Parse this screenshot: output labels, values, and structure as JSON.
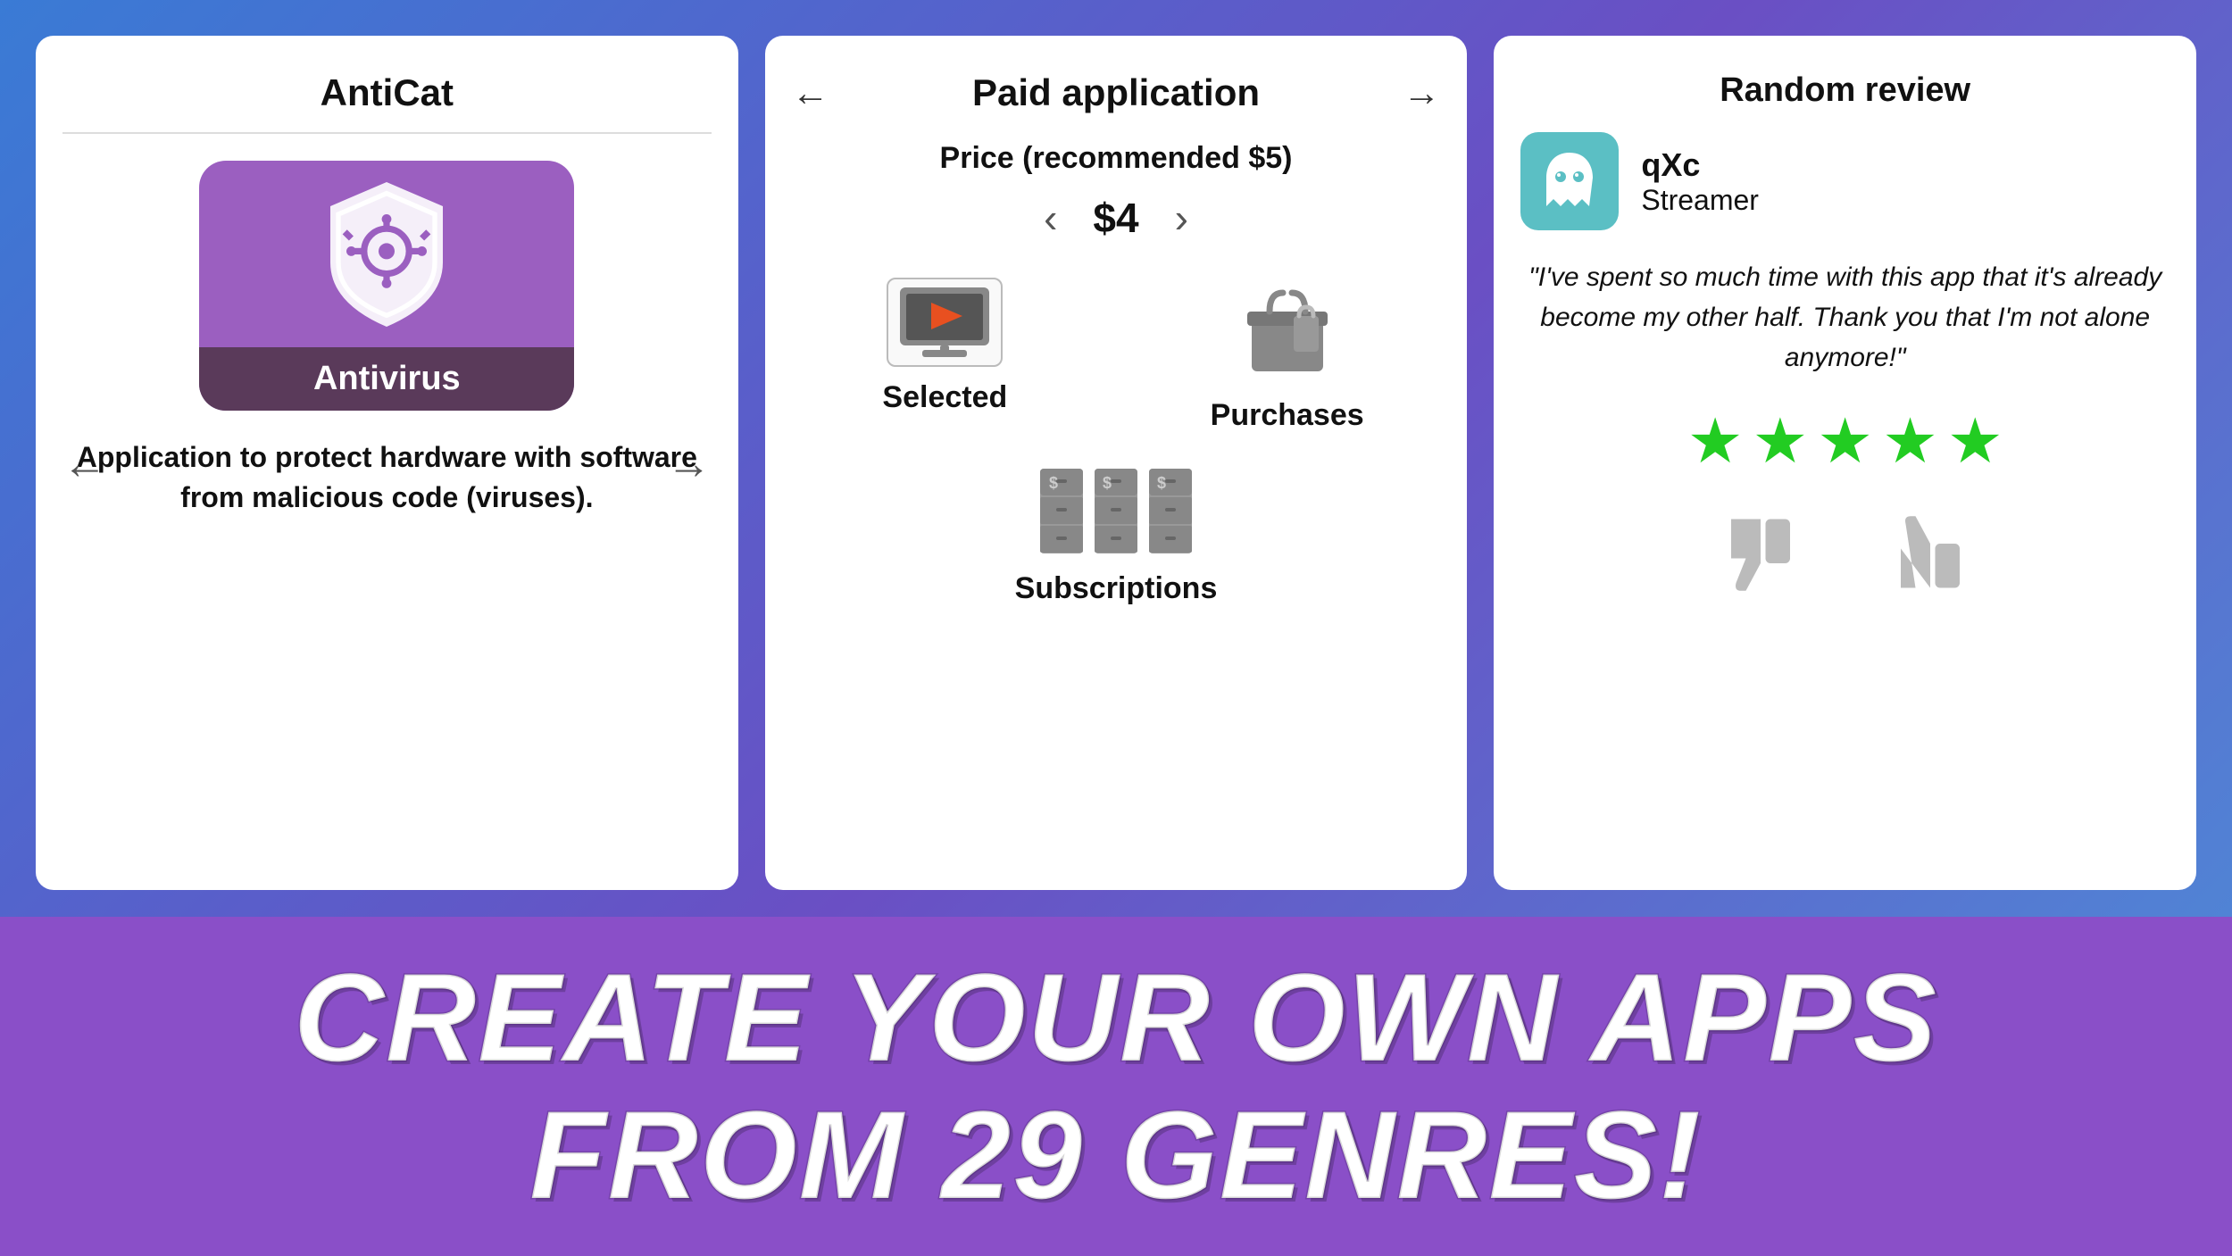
{
  "card1": {
    "title": "AntiCat",
    "app_name": "Antivirus",
    "description": "Application to protect hardware with software from malicious code (viruses).",
    "nav_left": "←",
    "nav_right": "→"
  },
  "card2": {
    "header": "Paid application",
    "nav_left": "←",
    "nav_right": "→",
    "price_label": "Price (recommended $5)",
    "price": "$4",
    "price_prev": "‹",
    "price_next": "›",
    "options": [
      {
        "label": "Selected",
        "type": "selected"
      },
      {
        "label": "Purchases",
        "type": "purchases"
      },
      {
        "label": "Subscriptions",
        "type": "subscriptions"
      }
    ]
  },
  "card3": {
    "header": "Random review",
    "reviewer_name": "qXc",
    "reviewer_role": "Streamer",
    "review_text": "\"I've spent so much time with this app that it's already become my other half. Thank you that I'm not alone anymore!\"",
    "stars": 5,
    "thumbs_down": "👎",
    "thumbs_up": "👍"
  },
  "banner": {
    "line1": "CREATE YOUR OWN APPS",
    "line2": "FROM 29 GENRES!"
  }
}
